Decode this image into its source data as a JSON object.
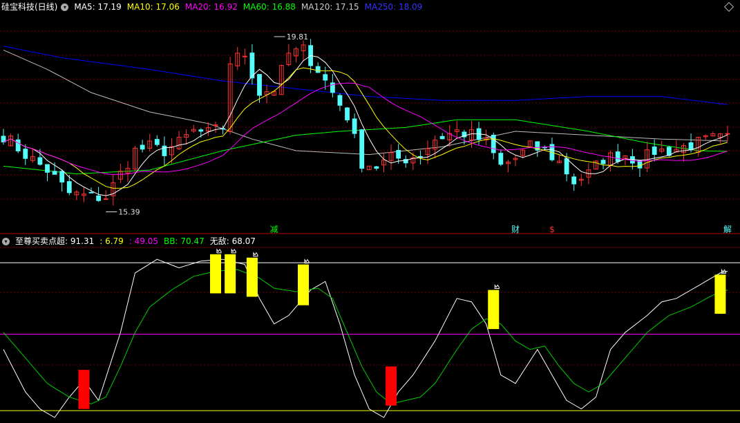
{
  "main_header": {
    "stock_name": "硅宝科技(日线)",
    "ma5": "MA5: 17.19",
    "ma10": "MA10: 17.06",
    "ma20": "MA20: 16.92",
    "ma60": "MA60: 16.88",
    "ma120": "MA120: 17.15",
    "ma250": "MA250: 18.09"
  },
  "indicator_header": {
    "name": "至尊买卖点超",
    "v1": ": 91.31",
    "v2": ": 6.79",
    "v3": ": 49.05",
    "bb": "BB: 70.47",
    "wudi": "无敌: 68.07"
  },
  "colors": {
    "up": "#ff3232",
    "down": "#54fcfc",
    "ma5": "#ffffff",
    "ma10": "#ffff00",
    "ma20": "#ff00ff",
    "ma60": "#00ff00",
    "ma120": "#bbbbbb",
    "ma250": "#0000ff",
    "buy_bar": "#ff0000",
    "sell_bar": "#ffff00"
  },
  "chart_data": [
    {
      "type": "candlestick",
      "panel": "price",
      "ylim": [
        14.9,
        20.4
      ],
      "x_count": 100,
      "high_label": "19.81",
      "low_label": "15.39",
      "markers": [
        {
          "label": "减",
          "x": 37,
          "color": "#00ff00"
        },
        {
          "label": "财",
          "x": 70,
          "color": "#54fcfc"
        },
        {
          "label": "$",
          "x": 75,
          "color": "#ff3232"
        },
        {
          "label": "解",
          "x": 99,
          "color": "#54fcfc"
        }
      ],
      "anchors": [
        [
          0,
          17.3
        ],
        [
          3,
          16.8
        ],
        [
          6,
          16.4
        ],
        [
          9,
          15.8
        ],
        [
          12,
          15.7
        ],
        [
          14,
          15.7
        ],
        [
          16,
          16.3
        ],
        [
          18,
          16.9
        ],
        [
          20,
          17.0
        ],
        [
          22,
          16.9
        ],
        [
          24,
          17.1
        ],
        [
          26,
          17.4
        ],
        [
          28,
          17.35
        ],
        [
          30,
          17.5
        ],
        [
          31,
          19.2
        ],
        [
          33,
          19.4
        ],
        [
          35,
          18.4
        ],
        [
          37,
          18.5
        ],
        [
          39,
          19.4
        ],
        [
          41,
          19.5
        ],
        [
          43,
          19.0
        ],
        [
          45,
          18.4
        ],
        [
          47,
          17.8
        ],
        [
          49,
          16.6
        ],
        [
          51,
          16.5
        ],
        [
          53,
          16.7
        ],
        [
          55,
          16.7
        ],
        [
          57,
          16.8
        ],
        [
          59,
          17.2
        ],
        [
          62,
          17.4
        ],
        [
          64,
          17.3
        ],
        [
          66,
          17.1
        ],
        [
          68,
          16.5
        ],
        [
          70,
          16.7
        ],
        [
          72,
          17.0
        ],
        [
          74,
          16.9
        ],
        [
          76,
          16.6
        ],
        [
          78,
          16.1
        ],
        [
          80,
          16.3
        ],
        [
          82,
          16.7
        ],
        [
          85,
          16.8
        ],
        [
          87,
          16.6
        ],
        [
          89,
          16.9
        ],
        [
          91,
          16.9
        ],
        [
          93,
          17.0
        ],
        [
          95,
          17.1
        ],
        [
          97,
          17.2
        ],
        [
          99,
          17.2
        ]
      ],
      "ma250": [
        [
          0,
          19.6
        ],
        [
          8,
          19.3
        ],
        [
          20,
          19.0
        ],
        [
          30,
          18.7
        ],
        [
          40,
          18.5
        ],
        [
          50,
          18.3
        ],
        [
          60,
          18.2
        ],
        [
          70,
          18.2
        ],
        [
          80,
          18.3
        ],
        [
          90,
          18.3
        ],
        [
          99,
          18.09
        ]
      ],
      "ma120": [
        [
          0,
          19.5
        ],
        [
          6,
          19.0
        ],
        [
          12,
          18.4
        ],
        [
          20,
          17.9
        ],
        [
          28,
          17.6
        ],
        [
          34,
          17.2
        ],
        [
          40,
          16.9
        ],
        [
          50,
          16.8
        ],
        [
          60,
          17.0
        ],
        [
          70,
          17.4
        ],
        [
          80,
          17.3
        ],
        [
          90,
          17.2
        ],
        [
          99,
          17.15
        ]
      ],
      "ma60": [
        [
          0,
          16.5
        ],
        [
          10,
          16.3
        ],
        [
          20,
          16.4
        ],
        [
          30,
          16.9
        ],
        [
          40,
          17.3
        ],
        [
          46,
          17.4
        ],
        [
          55,
          17.5
        ],
        [
          62,
          17.7
        ],
        [
          70,
          17.7
        ],
        [
          80,
          17.4
        ],
        [
          88,
          17.1
        ],
        [
          95,
          16.9
        ],
        [
          99,
          16.88
        ]
      ]
    },
    {
      "type": "line",
      "panel": "indicator",
      "ylim": [
        0,
        100
      ],
      "levels": [
        {
          "value": 91,
          "color": "#ffffff"
        },
        {
          "value": 49,
          "color": "#ff00ff"
        },
        {
          "value": 4,
          "color": "#ffff00"
        }
      ],
      "series": [
        {
          "color": "#ffffff",
          "values": [
            [
              0,
              40
            ],
            [
              3,
              15
            ],
            [
              5,
              5
            ],
            [
              7,
              0
            ],
            [
              9,
              12
            ],
            [
              11,
              22
            ],
            [
              13,
              10
            ],
            [
              16,
              50
            ],
            [
              18,
              85
            ],
            [
              21,
              93
            ],
            [
              24,
              88
            ],
            [
              27,
              92
            ],
            [
              30,
              93
            ],
            [
              33,
              90
            ],
            [
              35,
              70
            ],
            [
              37,
              55
            ],
            [
              39,
              60
            ],
            [
              42,
              75
            ],
            [
              44,
              80
            ],
            [
              46,
              55
            ],
            [
              48,
              25
            ],
            [
              50,
              5
            ],
            [
              52,
              0
            ],
            [
              54,
              15
            ],
            [
              56,
              25
            ],
            [
              59,
              45
            ],
            [
              62,
              70
            ],
            [
              64,
              68
            ],
            [
              66,
              55
            ],
            [
              68,
              25
            ],
            [
              70,
              20
            ],
            [
              73,
              40
            ],
            [
              75,
              25
            ],
            [
              77,
              10
            ],
            [
              79,
              5
            ],
            [
              81,
              12
            ],
            [
              83,
              40
            ],
            [
              85,
              50
            ],
            [
              88,
              60
            ],
            [
              90,
              68
            ],
            [
              92,
              70
            ],
            [
              94,
              75
            ],
            [
              96,
              80
            ],
            [
              98,
              85
            ],
            [
              99,
              86
            ]
          ]
        },
        {
          "color": "#00cc00",
          "values": [
            [
              0,
              50
            ],
            [
              3,
              35
            ],
            [
              6,
              20
            ],
            [
              9,
              12
            ],
            [
              12,
              8
            ],
            [
              14,
              12
            ],
            [
              16,
              30
            ],
            [
              18,
              50
            ],
            [
              20,
              65
            ],
            [
              23,
              75
            ],
            [
              26,
              83
            ],
            [
              29,
              86
            ],
            [
              32,
              87
            ],
            [
              35,
              82
            ],
            [
              37,
              76
            ],
            [
              40,
              74
            ],
            [
              43,
              76
            ],
            [
              45,
              70
            ],
            [
              47,
              50
            ],
            [
              49,
              30
            ],
            [
              51,
              15
            ],
            [
              53,
              8
            ],
            [
              55,
              10
            ],
            [
              57,
              12
            ],
            [
              59,
              20
            ],
            [
              62,
              40
            ],
            [
              64,
              52
            ],
            [
              66,
              58
            ],
            [
              68,
              55
            ],
            [
              70,
              45
            ],
            [
              72,
              40
            ],
            [
              74,
              42
            ],
            [
              76,
              30
            ],
            [
              78,
              20
            ],
            [
              80,
              15
            ],
            [
              82,
              20
            ],
            [
              85,
              35
            ],
            [
              88,
              50
            ],
            [
              91,
              60
            ],
            [
              94,
              65
            ],
            [
              97,
              72
            ],
            [
              99,
              75
            ]
          ]
        }
      ],
      "bars": [
        {
          "x": 11,
          "from": 5,
          "to": 28,
          "kind": "buy"
        },
        {
          "x": 29,
          "from": 73,
          "to": 96,
          "kind": "sell"
        },
        {
          "x": 31,
          "from": 73,
          "to": 96,
          "kind": "sell"
        },
        {
          "x": 34,
          "from": 71,
          "to": 94,
          "kind": "sell"
        },
        {
          "x": 41,
          "from": 66,
          "to": 90,
          "kind": "sell"
        },
        {
          "x": 53,
          "from": 7,
          "to": 30,
          "kind": "buy"
        },
        {
          "x": 67,
          "from": 52,
          "to": 75,
          "kind": "sell"
        },
        {
          "x": 98,
          "from": 61,
          "to": 84,
          "kind": "sell"
        }
      ]
    }
  ]
}
